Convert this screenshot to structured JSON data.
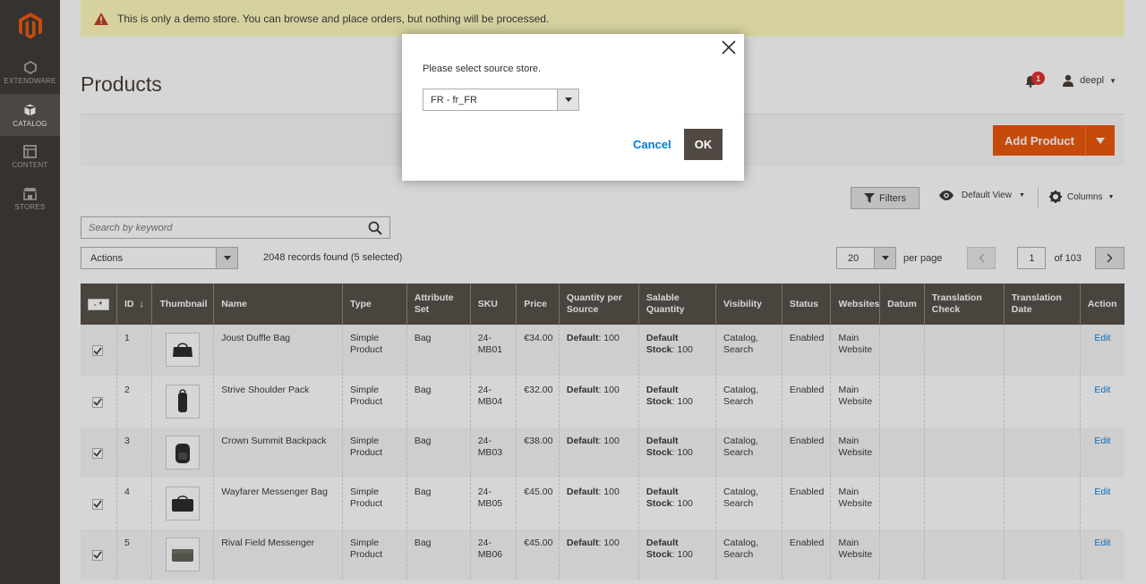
{
  "sidebar": {
    "items": [
      {
        "label": "EXTENDWARE"
      },
      {
        "label": "CATALOG"
      },
      {
        "label": "CONTENT"
      },
      {
        "label": "STORES"
      }
    ]
  },
  "notice": {
    "text": "This is only a demo store. You can browse and place orders, but nothing will be processed."
  },
  "header": {
    "title": "Products",
    "notifications_count": "1",
    "username": "deepl"
  },
  "actions_bar": {
    "add_product_label": "Add Product"
  },
  "toolbar": {
    "filters_label": "Filters",
    "view_label": "Default View",
    "columns_label": "Columns"
  },
  "search": {
    "placeholder": "Search by keyword"
  },
  "mass_actions": {
    "label": "Actions"
  },
  "records_text": "2048 records found (5 selected)",
  "pager": {
    "per_page_value": "20",
    "per_page_label": "per page",
    "current_page": "1",
    "of_label": "of 103"
  },
  "grid": {
    "mass_select_label": "-",
    "columns": {
      "id": "ID",
      "thumbnail": "Thumbnail",
      "name": "Name",
      "type": "Type",
      "attr1": "Attribute",
      "attr2": "Set",
      "sku": "SKU",
      "price": "Price",
      "qty1": "Quantity per",
      "qty2": "Source",
      "sal1": "Salable",
      "sal2": "Quantity",
      "visibility": "Visibility",
      "status": "Status",
      "websites": "Websites",
      "datum": "Datum",
      "tc1": "Translation",
      "tc2": "Check",
      "td1": "Translation",
      "td2": "Date",
      "action": "Action"
    },
    "rows": [
      {
        "id": "1",
        "name": "Joust Duffle Bag",
        "type1": "Simple",
        "type2": "Product",
        "attr": "Bag",
        "sku1": "24-",
        "sku2": "MB01",
        "price": "€34.00",
        "qty_label": "Default",
        "qty_value": ": 100",
        "sal_label1": "Default",
        "sal_label2": "Stock",
        "sal_value": ": 100",
        "vis1": "Catalog,",
        "vis2": "Search",
        "status": "Enabled",
        "web1": "Main",
        "web2": "Website",
        "action": "Edit"
      },
      {
        "id": "2",
        "name": "Strive Shoulder Pack",
        "type1": "Simple",
        "type2": "Product",
        "attr": "Bag",
        "sku1": "24-",
        "sku2": "MB04",
        "price": "€32.00",
        "qty_label": "Default",
        "qty_value": ": 100",
        "sal_label1": "Default",
        "sal_label2": "Stock",
        "sal_value": ": 100",
        "vis1": "Catalog,",
        "vis2": "Search",
        "status": "Enabled",
        "web1": "Main",
        "web2": "Website",
        "action": "Edit"
      },
      {
        "id": "3",
        "name": "Crown Summit Backpack",
        "type1": "Simple",
        "type2": "Product",
        "attr": "Bag",
        "sku1": "24-",
        "sku2": "MB03",
        "price": "€38.00",
        "qty_label": "Default",
        "qty_value": ": 100",
        "sal_label1": "Default",
        "sal_label2": "Stock",
        "sal_value": ": 100",
        "vis1": "Catalog,",
        "vis2": "Search",
        "status": "Enabled",
        "web1": "Main",
        "web2": "Website",
        "action": "Edit"
      },
      {
        "id": "4",
        "name": "Wayfarer Messenger Bag",
        "type1": "Simple",
        "type2": "Product",
        "attr": "Bag",
        "sku1": "24-",
        "sku2": "MB05",
        "price": "€45.00",
        "qty_label": "Default",
        "qty_value": ": 100",
        "sal_label1": "Default",
        "sal_label2": "Stock",
        "sal_value": ": 100",
        "vis1": "Catalog,",
        "vis2": "Search",
        "status": "Enabled",
        "web1": "Main",
        "web2": "Website",
        "action": "Edit"
      },
      {
        "id": "5",
        "name": "Rival Field Messenger",
        "type1": "Simple",
        "type2": "Product",
        "attr": "Bag",
        "sku1": "24-",
        "sku2": "MB06",
        "price": "€45.00",
        "qty_label": "Default",
        "qty_value": ": 100",
        "sal_label1": "Default",
        "sal_label2": "Stock",
        "sal_value": ": 100",
        "vis1": "Catalog,",
        "vis2": "Search",
        "status": "Enabled",
        "web1": "Main",
        "web2": "Website",
        "action": "Edit"
      }
    ]
  },
  "modal": {
    "message": "Please select source store.",
    "store_value": "FR - fr_FR",
    "cancel_label": "Cancel",
    "ok_label": "OK"
  },
  "colors": {
    "accent": "#eb5202",
    "sidebar": "#373330",
    "grid_header": "#514943",
    "link": "#007bdb"
  }
}
